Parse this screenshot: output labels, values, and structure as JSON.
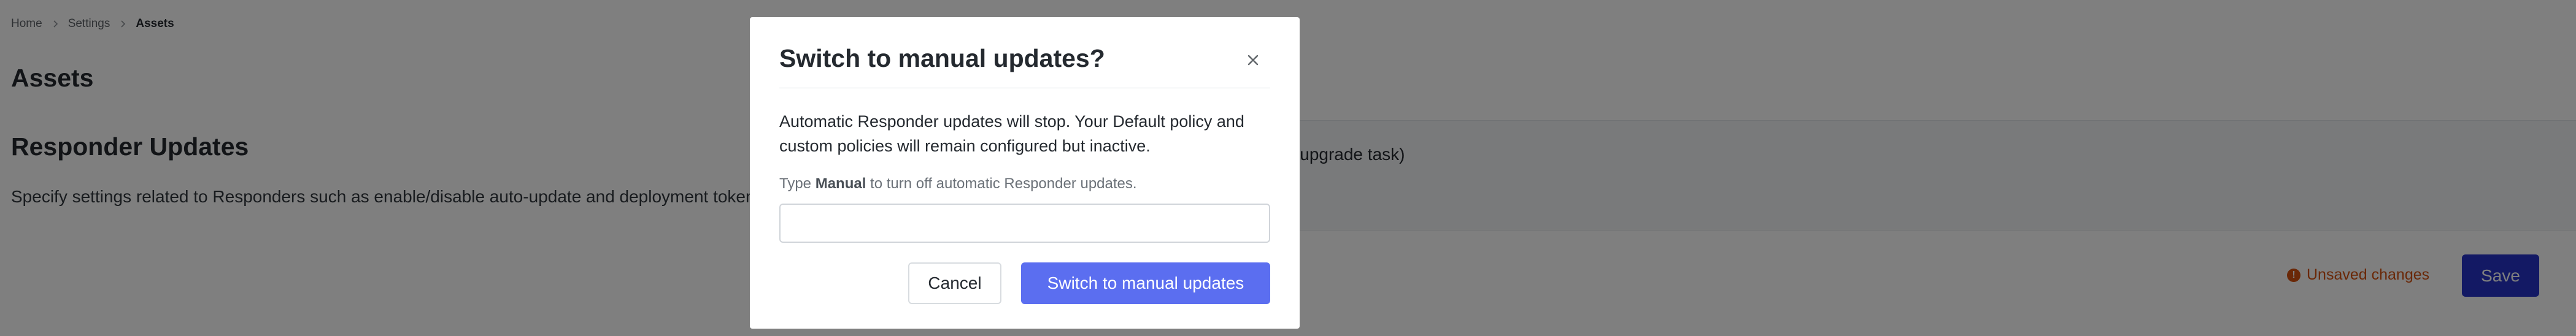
{
  "breadcrumb": {
    "items": [
      "Home",
      "Settings",
      "Assets"
    ]
  },
  "page": {
    "title": "Assets"
  },
  "section": {
    "title": "Responder Updates",
    "description": "Specify settings related to Responders such as enable/disable auto-update and deployment tokens."
  },
  "settings_panel": {
    "text": "(on upgrade task)"
  },
  "footer": {
    "unsaved_label": "Unsaved changes",
    "save_label": "Save",
    "warning_icon": "alert-circle-icon"
  },
  "modal": {
    "title": "Switch to manual updates?",
    "close_icon": "close-icon",
    "body": "Automatic Responder updates will stop. Your Default policy and custom policies will remain configured but inactive.",
    "hint_prefix": "Type ",
    "hint_keyword": "Manual",
    "hint_suffix": " to turn off automatic Responder updates.",
    "input_value": "",
    "cancel_label": "Cancel",
    "confirm_label": "Switch to manual updates"
  },
  "colors": {
    "primary": "#5b6ef0",
    "save": "#2633c9",
    "warning": "#d4500f"
  }
}
